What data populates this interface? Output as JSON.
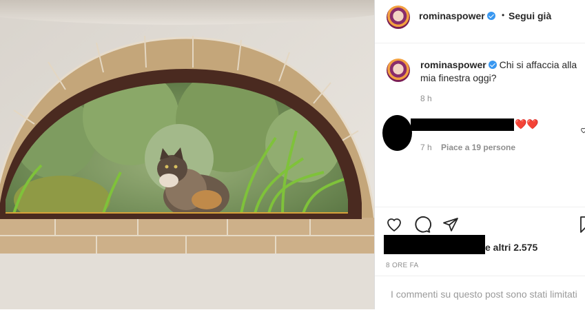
{
  "post": {
    "username": "rominaspower",
    "follow_status": "Segui già",
    "separator": "•",
    "caption": "Chi si affaccia alla mia finestra oggi?",
    "caption_time": "8 h"
  },
  "comment": {
    "emoji": "❤️❤️",
    "time": "7 h",
    "likes": "Piace a 19 persone"
  },
  "engagement": {
    "likes_suffix": "e altri 2.575",
    "posted_ago": "8 ORE FA"
  },
  "footer": {
    "limited_comments": "I commenti su questo post sono stati limitati"
  },
  "icons": [
    "heart-icon",
    "comment-icon",
    "share-icon",
    "bookmark-icon"
  ],
  "colors": {
    "verified": "#3897f0",
    "secondary_text": "#8e8e8e"
  }
}
